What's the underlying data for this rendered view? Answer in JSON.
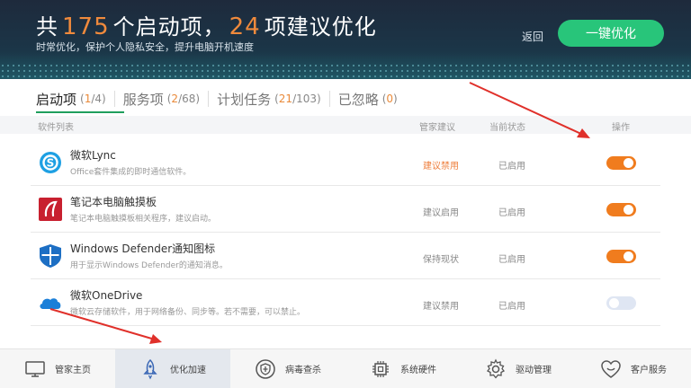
{
  "header": {
    "headline": {
      "prefix": "共",
      "startup_count": "175",
      "middle": "个启动项，",
      "suggest_count": "24",
      "suffix": "项建议优化"
    },
    "subtitle": "时常优化，保护个人隐私安全，提升电脑开机速度",
    "back_label": "返回",
    "optimize_label": "一键优化"
  },
  "tabs": [
    {
      "label": "启动项",
      "highlight": "1",
      "total": "4"
    },
    {
      "label": "服务项",
      "highlight": "2",
      "total": "68"
    },
    {
      "label": "计划任务",
      "highlight": "21",
      "total": "103"
    },
    {
      "label": "已忽略",
      "highlight": "0",
      "total": ""
    }
  ],
  "table": {
    "columns": {
      "software": "软件列表",
      "advice": "管家建议",
      "status": "当前状态",
      "action": "操作"
    },
    "rows": [
      {
        "name": "微软Lync",
        "desc": "Office套件集成的即时通信软件。",
        "advice": "建议禁用",
        "advice_warn": true,
        "status": "已启用",
        "enabled": true,
        "icon": "skype-icon"
      },
      {
        "name": "笔记本电脑触摸板",
        "desc": "笔记本电脑触摸板相关程序，建议启动。",
        "advice": "建议启用",
        "advice_warn": false,
        "status": "已启用",
        "enabled": true,
        "icon": "touchpad-icon"
      },
      {
        "name": "Windows Defender通知图标",
        "desc": "用于显示Windows Defender的通知消息。",
        "advice": "保持现状",
        "advice_warn": false,
        "status": "已启用",
        "enabled": true,
        "icon": "defender-shield-icon"
      },
      {
        "name": "微软OneDrive",
        "desc": "微软云存储软件，用于网络备份、同步等。若不需要，可以禁止。",
        "advice": "建议禁用",
        "advice_warn": false,
        "status": "已启用",
        "enabled": false,
        "icon": "onedrive-cloud-icon"
      }
    ]
  },
  "bottom_nav": [
    {
      "label": "管家主页",
      "icon": "monitor-icon"
    },
    {
      "label": "优化加速",
      "icon": "rocket-icon"
    },
    {
      "label": "病毒查杀",
      "icon": "shield-plus-icon"
    },
    {
      "label": "系统硬件",
      "icon": "chip-icon"
    },
    {
      "label": "驱动管理",
      "icon": "gear-icon"
    },
    {
      "label": "客户服务",
      "icon": "heart-icon"
    }
  ],
  "colors": {
    "accent_green": "#28c57a",
    "count_orange": "#f08a3c",
    "toggle_on": "#f07c1e",
    "toggle_off": "#dfe6f3",
    "annotation_red": "#e0302a"
  }
}
